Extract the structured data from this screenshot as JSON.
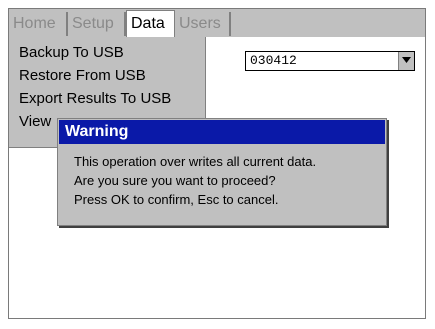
{
  "tabs": [
    {
      "label": "Home"
    },
    {
      "label": "Setup"
    },
    {
      "label": "Data"
    },
    {
      "label": "Users"
    }
  ],
  "menu": {
    "items": [
      {
        "label": "Backup To USB"
      },
      {
        "label": "Restore From USB"
      },
      {
        "label": "Export Results To USB"
      },
      {
        "label": "View"
      }
    ]
  },
  "select": {
    "value": "030412"
  },
  "dialog": {
    "title": "Warning",
    "lines": [
      "This operation over writes all current data.",
      "Are you sure you want to proceed?",
      "Press OK to confirm, Esc to cancel."
    ]
  },
  "colors": {
    "titlebar": "#0a19a8",
    "panel": "#c0c0c0"
  }
}
